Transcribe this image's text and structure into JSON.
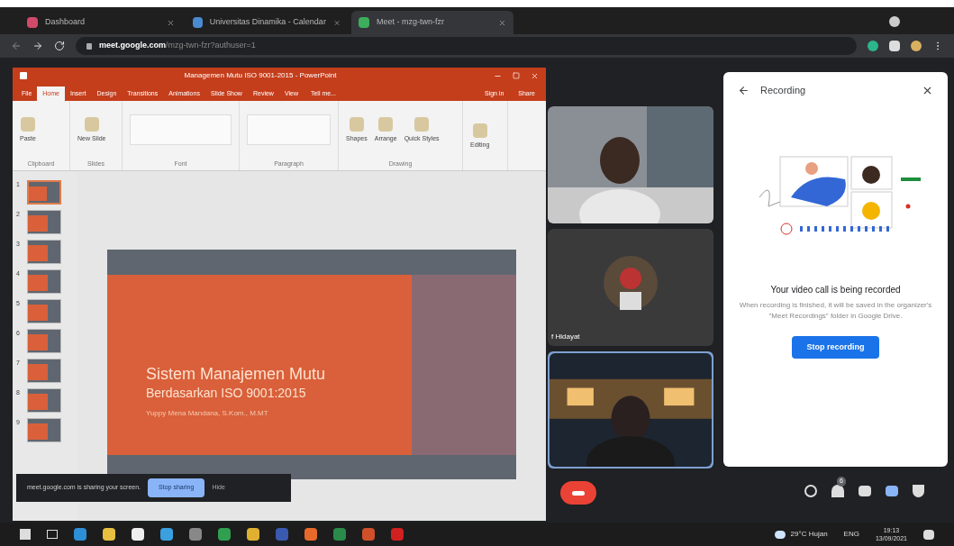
{
  "browser": {
    "tabs": [
      {
        "title": "Dashboard",
        "selected": false
      },
      {
        "title": "Universitas Dinamika - Calendar",
        "selected": false
      },
      {
        "title": "Meet - mzg-twn-fzr",
        "selected": true
      }
    ],
    "url_host": "meet.google.com",
    "url_path": "/mzg-twn-fzr?authuser=1"
  },
  "powerpoint": {
    "title": "Managemen Mutu ISO 9001-2015 - PowerPoint",
    "ribbon_tabs": [
      {
        "label": "File",
        "selected": false
      },
      {
        "label": "Home",
        "selected": true
      },
      {
        "label": "Insert",
        "selected": false
      },
      {
        "label": "Design",
        "selected": false
      },
      {
        "label": "Transitions",
        "selected": false
      },
      {
        "label": "Animations",
        "selected": false
      },
      {
        "label": "Slide Show",
        "selected": false
      },
      {
        "label": "Review",
        "selected": false
      },
      {
        "label": "View",
        "selected": false
      }
    ],
    "tell_me": "Tell me...",
    "sign_in": "Sign in",
    "share": "Share",
    "ribbon_groups": [
      {
        "label": "Clipboard",
        "buttons": [
          "Paste"
        ]
      },
      {
        "label": "Slides",
        "buttons": [
          "New Slide"
        ]
      },
      {
        "label": "Font"
      },
      {
        "label": "Paragraph"
      },
      {
        "label": "Drawing",
        "buttons": [
          "Shapes",
          "Arrange",
          "Quick Styles"
        ]
      },
      {
        "buttons": [
          "Editing"
        ]
      }
    ],
    "thumbnails": [
      {
        "number": "1",
        "selected": true
      },
      {
        "number": "2",
        "selected": false
      },
      {
        "number": "3",
        "selected": false
      },
      {
        "number": "4",
        "selected": false
      },
      {
        "number": "5",
        "selected": false
      },
      {
        "number": "6",
        "selected": false
      },
      {
        "number": "7",
        "selected": false
      },
      {
        "number": "8",
        "selected": false
      },
      {
        "number": "9",
        "selected": false
      }
    ],
    "slide": {
      "title": "Sistem Manajemen Mutu",
      "subtitle": "Berdasarkan ISO 9001:2015",
      "author": "Yuppy Mena Mandana, S.Kom., M.MT"
    }
  },
  "sharing_bar": {
    "message": "meet.google.com is sharing your screen.",
    "stop": "Stop sharing",
    "hide": "Hide"
  },
  "participants": [
    {
      "speaking": false
    },
    {
      "name": "f Hidayat",
      "speaking": false
    },
    {
      "speaking": true
    }
  ],
  "recording_panel": {
    "title": "Recording",
    "heading": "Your video call is being recorded",
    "body": "When recording is finished, it will be saved in the organizer's \"Meet Recordings\" folder in Google Drive.",
    "button": "Stop recording"
  },
  "meet_controls": {
    "people_count": "6"
  },
  "taskbar": {
    "weather": "29°C Hujan",
    "language": "ENG",
    "time": "19:13",
    "date": "13/09/2021"
  }
}
